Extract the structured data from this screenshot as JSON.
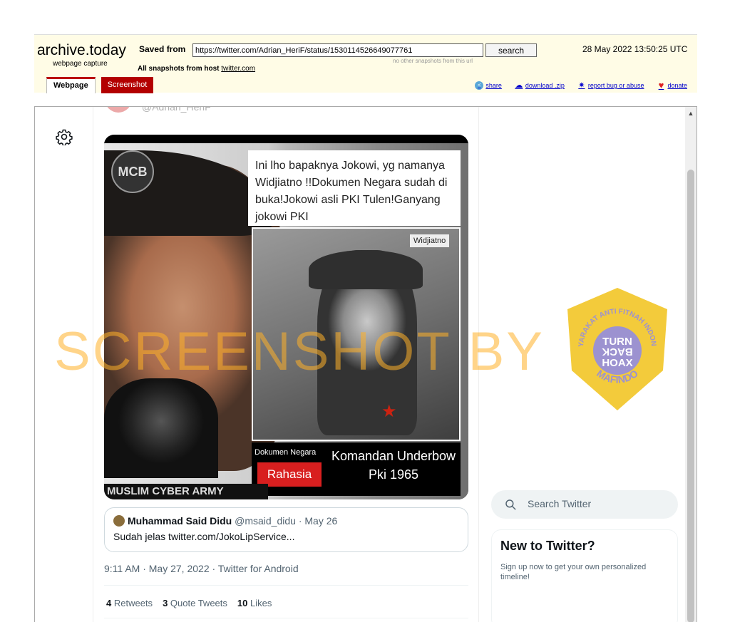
{
  "archive": {
    "brand": "archive.today",
    "brand_sub": "webpage capture",
    "saved_from_label": "Saved from",
    "url": "https://twitter.com/Adrian_HeriF/status/1530114526649077761",
    "no_other": "no other snapshots from this url",
    "search_label": "search",
    "date": "28 May 2022 13:50:25 UTC",
    "all_snapshots_label": "All snapshots",
    "from_host_label": "from host",
    "host": "twitter.com",
    "tab_webpage": "Webpage",
    "tab_screenshot": "Screenshot",
    "actions": {
      "share": "share",
      "download": "download .zip",
      "report": "report bug or abuse",
      "donate": "donate"
    }
  },
  "tweet": {
    "handle_peek": "@Adrian_HeriF",
    "image": {
      "logo": "MCB",
      "caption": "Ini lho bapaknya Jokowi, yg namanya Widjiatno !!Dokumen Negara sudah di buka!Jokowi asli PKI Tulen!Ganyang jokowi PKI",
      "name_tag": "Widjiatno",
      "dokumen": "Dokumen Negara",
      "rahasia": "Rahasia",
      "komandan": "Komandan Underbow Pki 1965",
      "muslim_cyber_army": "MUSLIM CYBER ARMY"
    },
    "quoted": {
      "name": "Muhammad Said Didu",
      "meta": "@msaid_didu · May 26",
      "text": "Sudah jelas twitter.com/JokoLipService..."
    },
    "timestamp": "9:11 AM · May 27, 2022 · Twitter for Android",
    "stats": {
      "retweets_count": "4",
      "retweets_label": "Retweets",
      "quotes_count": "3",
      "quotes_label": "Quote Tweets",
      "likes_count": "10",
      "likes_label": "Likes"
    }
  },
  "sidebar": {
    "search_placeholder": "Search Twitter",
    "new_title": "New to Twitter?",
    "new_desc": "Sign up now to get your own personalized timeline!"
  },
  "watermark": {
    "text": "SCREENSHOT BY",
    "badge_top": "MASYARAKAT ANTI FITNAH INDONESIA",
    "badge_line1": "TURN",
    "badge_line2": "BACK",
    "badge_line3": "HOAX",
    "badge_bottom": "MAFINDO"
  },
  "colors": {
    "archive_bg": "#fffce6",
    "tab_red": "#b30000",
    "twitter_secondary": "#536471",
    "watermark": "#ffb028"
  }
}
